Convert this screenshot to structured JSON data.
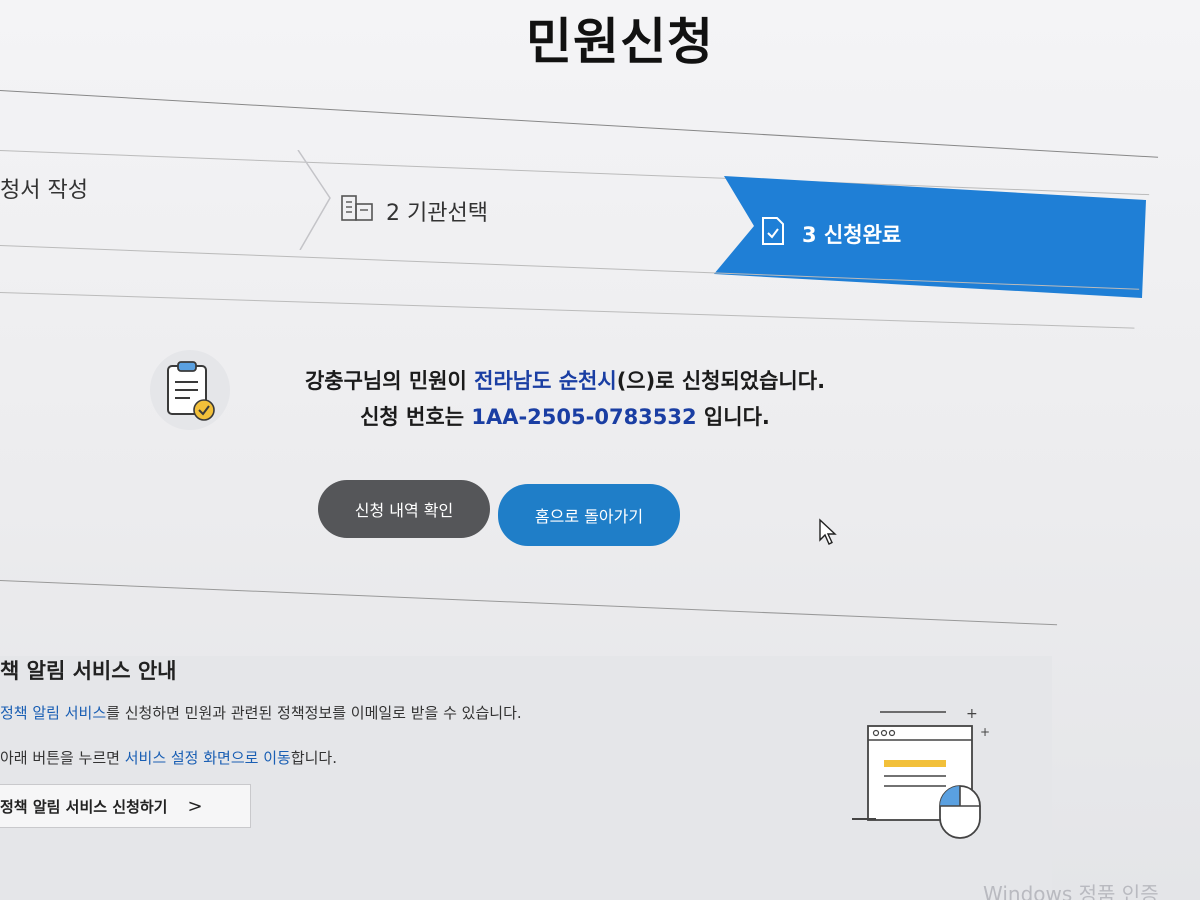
{
  "page": {
    "title": "민원신청"
  },
  "steps": {
    "step1_label": "청서 작성",
    "step2_label": "2 기관선택",
    "step3_label": "3 신청완료"
  },
  "result": {
    "line1_pre": "강충구님의 민원이 ",
    "agency": "전라남도 순천시",
    "line1_post": "(으)로 신청되었습니다.",
    "line2_pre": "신청 번호는 ",
    "application_number": "1AA-2505-0783532",
    "line2_post": " 입니다."
  },
  "buttons": {
    "history_label": "신청 내역 확인",
    "home_label": "홈으로 돌아가기"
  },
  "policy": {
    "title": "책 알림 서비스 안내",
    "line1_link": "정책 알림 서비스",
    "line1_rest": "를 신청하면 민원과 관련된 정책정보를 이메일로 받을 수 있습니다.",
    "line2_pre": "아래 버튼을 누르면 ",
    "line2_link": "서비스 설정 화면으로 이동",
    "line2_post": "합니다.",
    "button_label": "정책 알림 서비스 신청하기",
    "button_arrow": ">"
  },
  "watermark": "Windows 정품 인증",
  "colors": {
    "accent_blue": "#1f7ec8",
    "step_active": "#1f7fd6",
    "dark_button": "#555659",
    "link_blue": "#1a3ea3"
  },
  "icons": {
    "step2": "building-icon",
    "step3": "document-check-icon",
    "result": "clipboard-check-icon",
    "policy": "browser-mouse-illustration",
    "cursor": "mouse-pointer-icon"
  }
}
